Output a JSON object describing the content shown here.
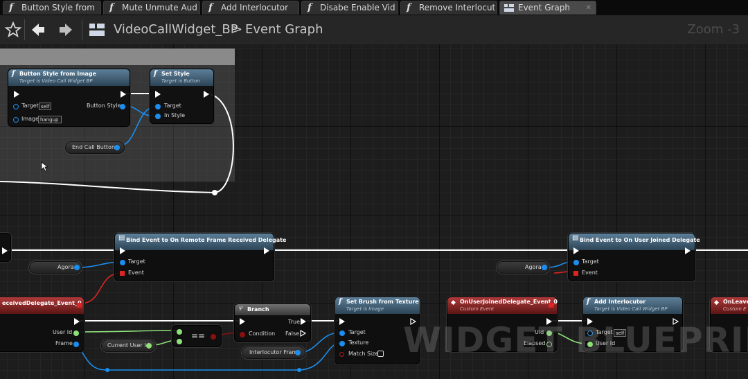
{
  "tabs": [
    {
      "label": "Button Style from",
      "icon": "function-icon"
    },
    {
      "label": "Mute Unmute Aud",
      "icon": "function-icon"
    },
    {
      "label": "Add Interlocutor",
      "icon": "function-icon"
    },
    {
      "label": "Disabe Enable Vid",
      "icon": "function-icon"
    },
    {
      "label": "Remove Interlocut",
      "icon": "function-icon"
    },
    {
      "label": "Event Graph",
      "icon": "graph-icon",
      "active": true
    }
  ],
  "toolbar": {
    "breadcrumb_blueprint": "VideoCallWidget_BP",
    "breadcrumb_separator": ">",
    "breadcrumb_graph": "Event Graph",
    "zoom": "Zoom -3"
  },
  "nodes": {
    "button_style": {
      "title": "Button Style from Image",
      "subtitle": "Target is Video Call Widget BP",
      "pin_target": "Target",
      "target_value": "self",
      "pin_image": "Image",
      "image_value": "hangup",
      "pin_out": "Button Style"
    },
    "set_style": {
      "title": "Set Style",
      "subtitle": "Target is Button",
      "pin_target": "Target",
      "pin_in_style": "In Style"
    },
    "end_call": {
      "label": "End Call Button"
    },
    "bind_remote": {
      "title": "Bind Event to On Remote Frame Received Delegate",
      "pin_target": "Target",
      "pin_event": "Event"
    },
    "agora_left": {
      "label": "Agora"
    },
    "bind_joined": {
      "title": "Bind Event to On User Joined Delegate",
      "pin_target": "Target",
      "pin_event": "Event"
    },
    "agora_right": {
      "label": "Agora"
    },
    "remote_event": {
      "title": "eceivedDelegate_Event_0",
      "pin_userid": "User Id",
      "pin_frame": "Frame"
    },
    "equals": {
      "label": "=="
    },
    "current_user": {
      "label": "Current User Id"
    },
    "branch": {
      "title": "Branch",
      "pin_condition": "Condition",
      "pin_true": "True",
      "pin_false": "False"
    },
    "set_brush": {
      "title": "Set Brush from Texture",
      "subtitle": "Target is Image",
      "pin_target": "Target",
      "pin_texture": "Texture",
      "pin_match": "Match Size"
    },
    "interlocutor_frame": {
      "label": "Interlocutor Frame"
    },
    "joined_event": {
      "title": "OnUserJoinedDelegate_Event_0",
      "subtitle": "Custom Event",
      "pin_uid": "Uid",
      "pin_elapsed": "Elapsed"
    },
    "add_interlocutor": {
      "title": "Add Interlocutor",
      "subtitle": "Target is Video Call Widget BP",
      "pin_target": "Target",
      "target_value": "self",
      "pin_userid": "User Id"
    },
    "on_leave": {
      "title": "OnLeave",
      "subtitle": "Custom E"
    }
  },
  "watermark": "WIDGET BLUEPRINT",
  "colors": {
    "exec": "#ffffff",
    "object_pin": "#1c8ef0",
    "int_pin": "#8ee07a",
    "delegate_pin": "#e02424",
    "function_header": "#3d5d75",
    "event_header": "#8a2525"
  }
}
